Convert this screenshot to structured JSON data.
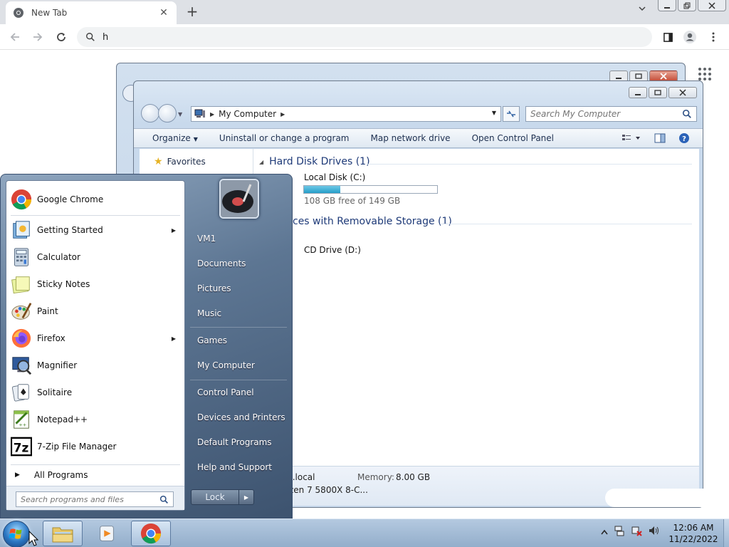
{
  "browser": {
    "tab_title": "New Tab",
    "omnibox_text": "h"
  },
  "explorer": {
    "breadcrumb": "My Computer",
    "search_placeholder": "Search My Computer",
    "commands": [
      "Organize",
      "Uninstall or change a program",
      "Map network drive",
      "Open Control Panel"
    ],
    "nav_favorites": "Favorites",
    "groups": {
      "hard_disk_header": "Hard Disk Drives (1)",
      "removable_header_partial": "ces with Removable Storage (1)"
    },
    "drives": {
      "local_disk_name": "Local Disk (C:)",
      "local_disk_free": "108 GB free of 149 GB",
      "local_disk_used_fraction": 0.275,
      "cd_drive_name": "CD Drive (D:)"
    },
    "details": {
      "domain_partial": "t.local",
      "memory_label": "Memory:",
      "memory_value": "8.00 GB",
      "processor_partial": "zen 7 5800X 8-C..."
    }
  },
  "start_menu": {
    "programs": [
      {
        "label": "Google Chrome",
        "icon": "chrome-icon",
        "submenu": false
      },
      {
        "label": "Getting Started",
        "icon": "getting-started-icon",
        "submenu": true
      },
      {
        "label": "Calculator",
        "icon": "calculator-icon",
        "submenu": false
      },
      {
        "label": "Sticky Notes",
        "icon": "sticky-notes-icon",
        "submenu": false
      },
      {
        "label": "Paint",
        "icon": "paint-icon",
        "submenu": false
      },
      {
        "label": "Firefox",
        "icon": "firefox-icon",
        "submenu": true
      },
      {
        "label": "Magnifier",
        "icon": "magnifier-icon",
        "submenu": false
      },
      {
        "label": "Solitaire",
        "icon": "solitaire-icon",
        "submenu": false
      },
      {
        "label": "Notepad++",
        "icon": "notepad-plus-plus-icon",
        "submenu": false
      },
      {
        "label": "7-Zip File Manager",
        "icon": "seven-zip-icon",
        "submenu": false
      }
    ],
    "all_programs": "All Programs",
    "search_placeholder": "Search programs and files",
    "right_items": [
      "VM1",
      "Documents",
      "Pictures",
      "Music",
      "Games",
      "My Computer",
      "Control Panel",
      "Devices and Printers",
      "Default Programs",
      "Help and Support"
    ],
    "lock_label": "Lock"
  },
  "taskbar": {
    "time": "12:06 AM",
    "date": "11/22/2022"
  }
}
